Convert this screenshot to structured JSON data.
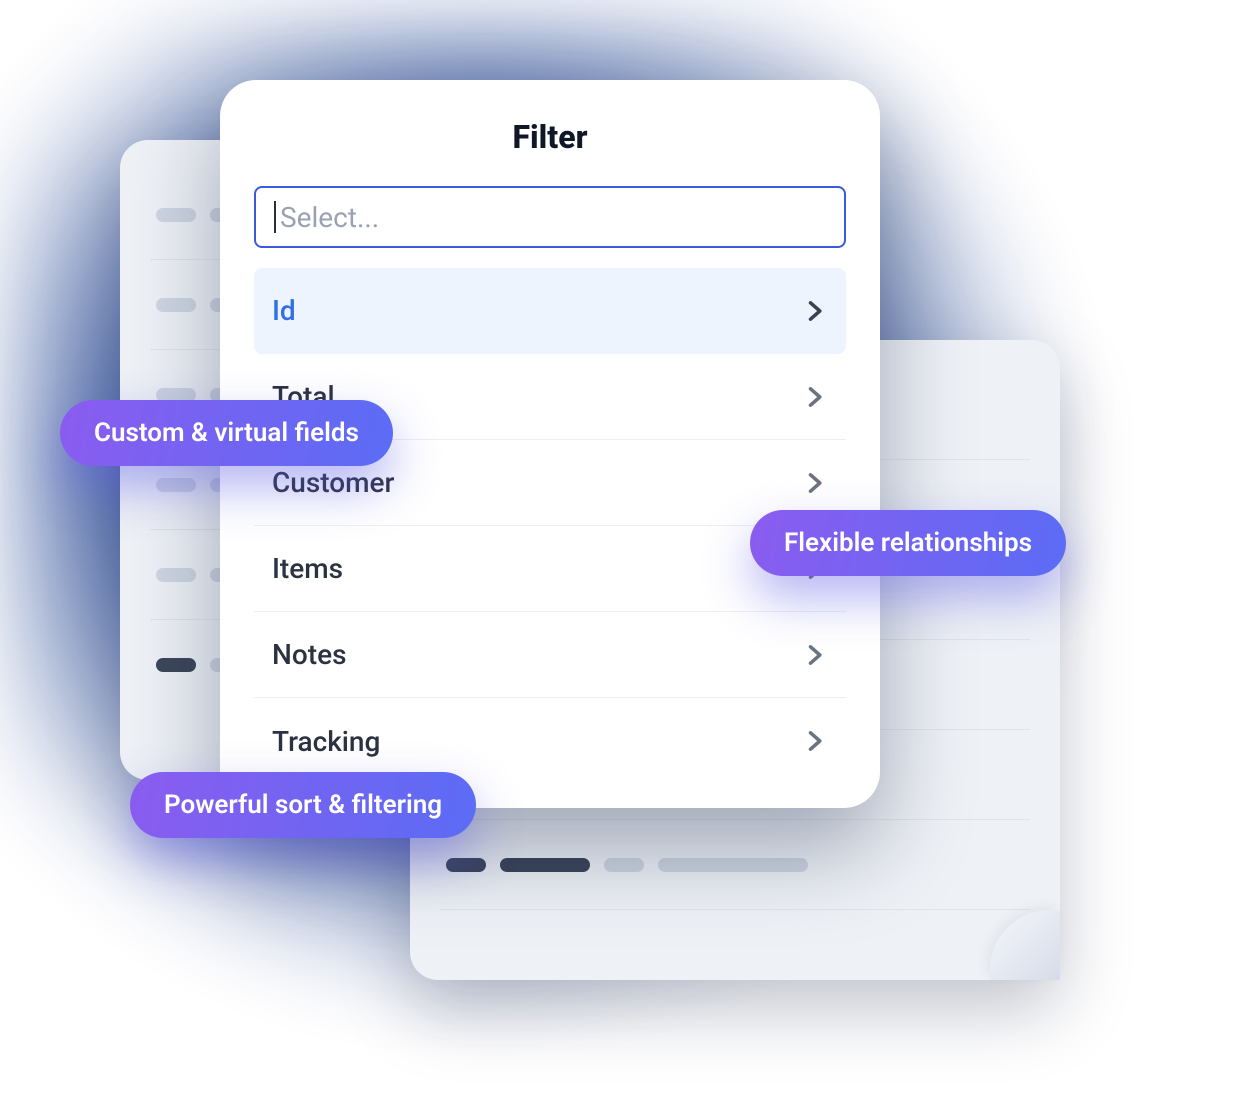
{
  "filter": {
    "title": "Filter",
    "placeholder": "Select...",
    "options": [
      {
        "label": "Id",
        "selected": true
      },
      {
        "label": "Total",
        "selected": false
      },
      {
        "label": "Customer",
        "selected": false
      },
      {
        "label": "Items",
        "selected": false
      },
      {
        "label": "Notes",
        "selected": false
      },
      {
        "label": "Tracking",
        "selected": false
      }
    ]
  },
  "callouts": {
    "custom_fields": "Custom & virtual fields",
    "relationships": "Flexible relationships",
    "sort_filter": "Powerful sort & filtering"
  },
  "colors": {
    "accent_border": "#3b5bdb",
    "selected_text": "#2f6fe8",
    "pill_grad_from": "#8a5cf0",
    "pill_grad_to": "#5b6cf5",
    "blob": "#1a3d8f"
  }
}
